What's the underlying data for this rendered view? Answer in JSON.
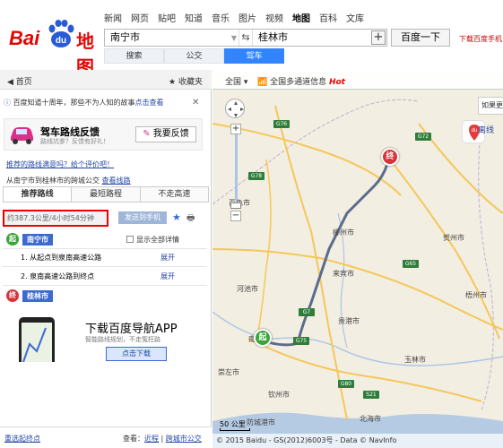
{
  "header": {
    "nav": [
      "新闻",
      "网页",
      "贴吧",
      "知道",
      "音乐",
      "图片",
      "视频",
      "地图",
      "百科",
      "文库"
    ],
    "active_nav": "地图",
    "start_value": "南宁市",
    "end_value": "桂林市",
    "search_button": "百度一下",
    "download_link": "下载百度手机",
    "modes": [
      "搜索",
      "公交",
      "驾车"
    ],
    "active_mode": "驾车",
    "logo_text_left": "Bai",
    "logo_text_du": "du",
    "logo_text_right": "地图"
  },
  "left": {
    "home": "首页",
    "favorites": "收藏夹",
    "notice": {
      "text": "百度知道十周年，那些不为人知的故事",
      "link": "点击查看"
    },
    "feedback": {
      "title": "驾车路线反馈",
      "subtitle": "路线坑爹？反馈有好礼！",
      "button": "我要反馈"
    },
    "rate_link": "推荐的路线满意吗？给个评价吧！",
    "route_desc": "从南宁市到桂林市的跨城公交",
    "route_desc_link": "查看线路",
    "tabs": [
      "推荐路线",
      "最短路程",
      "不走高速"
    ],
    "active_tab": "推荐路线",
    "summary": "约387.3公里/4小时54分钟",
    "send_button": "发送到手机",
    "start_city": "南宁市",
    "show_all": "显示全部详情",
    "steps": [
      {
        "text": "1. 从起点到泉南高速公路",
        "action": "展开"
      },
      {
        "text": "2. 泉南高速公路到终点",
        "action": "展开"
      }
    ],
    "end_city": "桂林市",
    "ad": {
      "title": "下载百度导航APP",
      "subtitle": "智能路线规划，不走冤枉路",
      "button": "点击下载"
    },
    "reset": "重选起终点",
    "view_label": "查看：",
    "view_links": [
      "近程",
      "跨城市公交"
    ],
    "badge_start": "起",
    "badge_end": "终"
  },
  "map": {
    "all": "全国",
    "traffic": "全国多通道信息",
    "hot": "Hot",
    "hint": "如果更",
    "side": "离线",
    "logo_icon": "du",
    "scale": "50 公里",
    "copyright": "© 2015 Baidu - GS(2012)6003号 - Data © NavInfo",
    "cities": [
      {
        "name": "柳州市"
      },
      {
        "name": "来宾市"
      },
      {
        "name": "贵港市"
      },
      {
        "name": "梧州市"
      },
      {
        "name": "玉林市"
      },
      {
        "name": "钦州市"
      },
      {
        "name": "防城港市"
      },
      {
        "name": "北海市"
      },
      {
        "name": "崇左市"
      },
      {
        "name": "百色市"
      },
      {
        "name": "河池市"
      },
      {
        "name": "贺州市"
      },
      {
        "name": "南宁"
      }
    ],
    "highways": [
      "G76",
      "G72",
      "G65",
      "G75",
      "G80",
      "G78",
      "S21",
      "G7"
    ],
    "pin_start": "起",
    "pin_end": "终"
  }
}
